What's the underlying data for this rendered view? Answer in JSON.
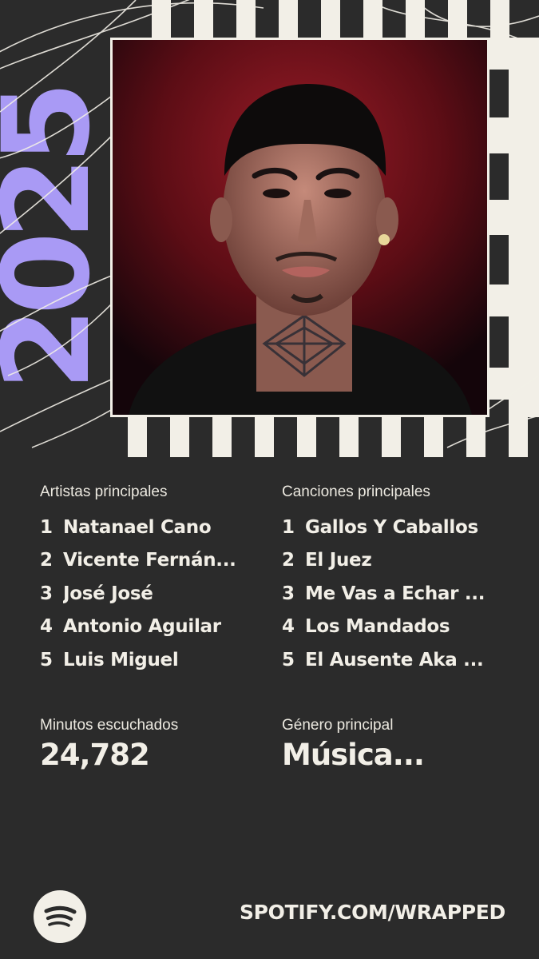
{
  "wrapped": {
    "year": "2025",
    "top_artists": {
      "label": "Artistas principales",
      "items": [
        {
          "rank": "1",
          "name": "Natanael Cano"
        },
        {
          "rank": "2",
          "name": "Vicente Fernán..."
        },
        {
          "rank": "3",
          "name": "José José"
        },
        {
          "rank": "4",
          "name": "Antonio Aguilar"
        },
        {
          "rank": "5",
          "name": "Luis Miguel"
        }
      ]
    },
    "top_songs": {
      "label": "Canciones principales",
      "items": [
        {
          "rank": "1",
          "name": "Gallos Y Caballos"
        },
        {
          "rank": "2",
          "name": "El Juez"
        },
        {
          "rank": "3",
          "name": "Me Vas a Echar ..."
        },
        {
          "rank": "4",
          "name": "Los Mandados"
        },
        {
          "rank": "5",
          "name": "El Ausente Aka ..."
        }
      ]
    },
    "minutes": {
      "label": "Minutos escuchados",
      "value": "24,782"
    },
    "genre": {
      "label": "Género principal",
      "value": "Música..."
    }
  },
  "footer": {
    "logo_icon": "spotify-logo-icon",
    "url": "SPOTIFY.COM/WRAPPED"
  },
  "colors": {
    "background": "#2b2b2b",
    "cream": "#f2efe7",
    "accent_purple": "#a99af5",
    "photo_red": "#8e1a24"
  }
}
